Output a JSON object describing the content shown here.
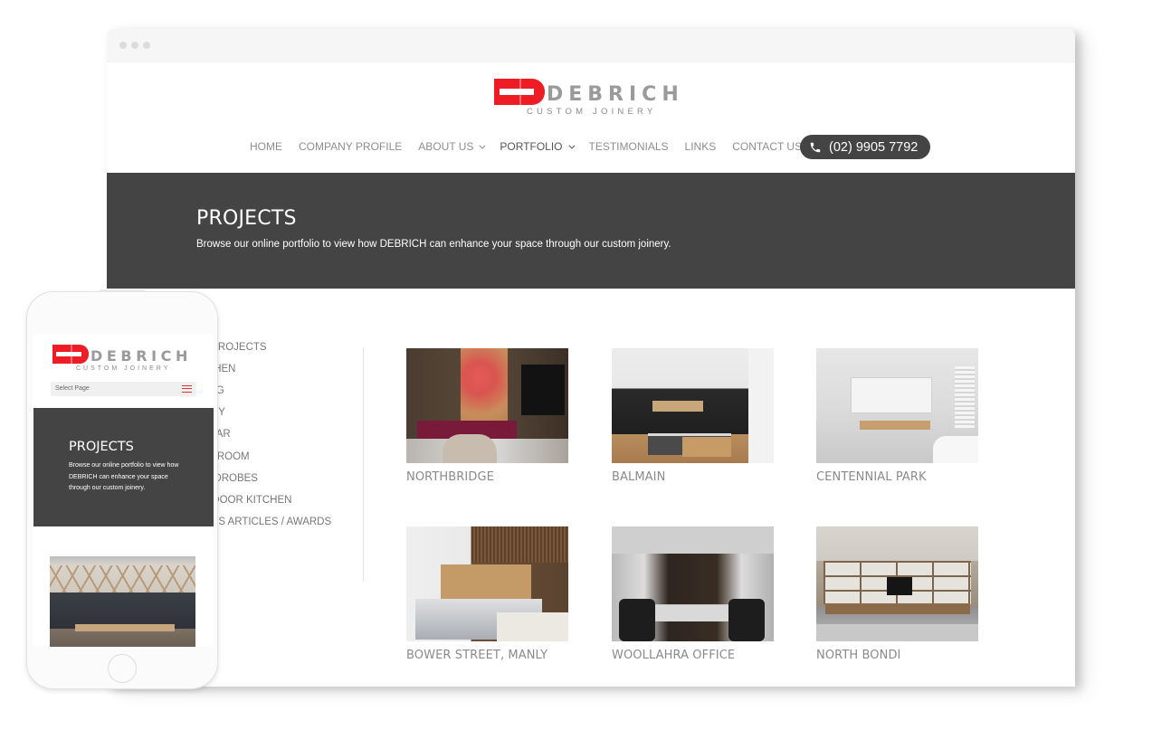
{
  "brand": {
    "name": "DEBRICH",
    "tagline": "CUSTOM JOINERY",
    "accent_color": "#ee1c25",
    "dark_color": "#444444"
  },
  "nav": {
    "items": [
      {
        "label": "HOME",
        "has_dropdown": false,
        "active": false
      },
      {
        "label": "COMPANY PROFILE",
        "has_dropdown": false,
        "active": false
      },
      {
        "label": "ABOUT US",
        "has_dropdown": true,
        "active": false
      },
      {
        "label": "PORTFOLIO",
        "has_dropdown": true,
        "active": true
      },
      {
        "label": "TESTIMONIALS",
        "has_dropdown": false,
        "active": false
      },
      {
        "label": "LINKS",
        "has_dropdown": false,
        "active": false
      },
      {
        "label": "CONTACT US",
        "has_dropdown": false,
        "active": false
      }
    ],
    "phone": "(02) 9905 7792",
    "phone_icon": "phone-icon"
  },
  "hero": {
    "title": "PROJECTS",
    "subtitle": "Browse our online portfolio to view how DEBRICH can enhance your space through our custom joinery."
  },
  "sidebar": {
    "items": [
      {
        "label": "ALL PROJECTS"
      },
      {
        "label": "KITCHEN"
      },
      {
        "label": "LIVING"
      },
      {
        "label": "STUDY"
      },
      {
        "label": "CELLAR"
      },
      {
        "label": "BATHROOM"
      },
      {
        "label": "WARDROBES"
      },
      {
        "label": "OUTDOOR KITCHEN"
      },
      {
        "label": "PRESS ARTICLES / AWARDS"
      }
    ]
  },
  "projects": [
    {
      "label": "NORTHBRIDGE"
    },
    {
      "label": "BALMAIN"
    },
    {
      "label": "CENTENNIAL PARK"
    },
    {
      "label": "BOWER STREET, MANLY"
    },
    {
      "label": "WOOLLAHRA OFFICE"
    },
    {
      "label": "NORTH BONDI"
    }
  ],
  "mobile": {
    "select_page": "Select Page",
    "menu_icon": "hamburger-icon",
    "hero_title": "PROJECTS",
    "hero_subtitle": "Browse our online portfolio to view how DEBRICH can enhance your space through our custom joinery."
  }
}
